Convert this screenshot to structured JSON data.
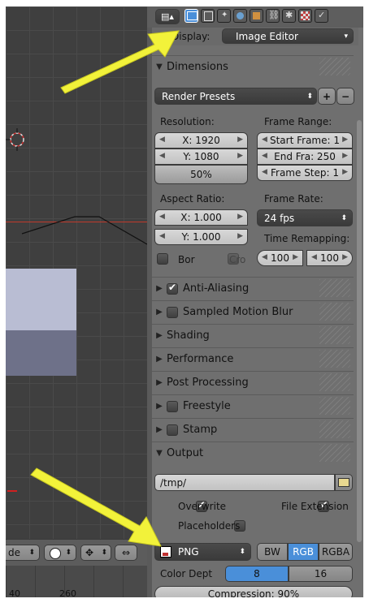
{
  "viewport": {
    "mode_label": "de",
    "ruler": [
      "40",
      "260"
    ]
  },
  "header": {
    "display_label": "Display:",
    "display_value": "Image Editor",
    "tabs": [
      "render-icon",
      "render-layers-icon",
      "scene-icon",
      "world-icon",
      "object-icon",
      "constraints-icon",
      "modifiers-icon",
      "texture-icon",
      "particles-icon"
    ]
  },
  "dimensions": {
    "title": "Dimensions",
    "presets": "Render Presets",
    "resolution_label": "Resolution:",
    "res_x": "X: 1920",
    "res_y": "Y: 1080",
    "res_pct": "50%",
    "frame_range_label": "Frame Range:",
    "start_frame": "Start Frame: 1",
    "end_frame": "End Fra: 250",
    "frame_step": "Frame Step: 1",
    "aspect_label": "Aspect Ratio:",
    "aspect_x": "X: 1.000",
    "aspect_y": "Y: 1.000",
    "frame_rate_label": "Frame Rate:",
    "frame_rate": "24 fps",
    "time_remap_label": "Time Remapping:",
    "remap_old": "100",
    "remap_new": "100",
    "border_label": "Bor",
    "crop_label": "Cro"
  },
  "sections": [
    {
      "label": "Anti-Aliasing",
      "checkbox": true,
      "checked": true
    },
    {
      "label": "Sampled Motion Blur",
      "checkbox": true,
      "checked": false
    },
    {
      "label": "Shading",
      "checkbox": false
    },
    {
      "label": "Performance",
      "checkbox": false
    },
    {
      "label": "Post Processing",
      "checkbox": false
    },
    {
      "label": "Freestyle",
      "checkbox": true,
      "checked": false
    },
    {
      "label": "Stamp",
      "checkbox": true,
      "checked": false
    }
  ],
  "output": {
    "title": "Output",
    "path": "/tmp/",
    "overwrite_label": "Overwrite",
    "file_ext_label": "File Extension",
    "placeholders_label": "Placeholders",
    "format": "PNG",
    "bw": "BW",
    "rgb": "RGB",
    "rgba": "RGBA",
    "color_depth_label": "Color Dept",
    "depth_8": "8",
    "depth_16": "16",
    "compression": "Compression: 90%"
  },
  "colors": {
    "panel_bg": "#6f6f6f",
    "accent_blue": "#4a8fd9",
    "arrow_yellow": "#f2f23a",
    "x_axis_red": "#c0392b"
  }
}
